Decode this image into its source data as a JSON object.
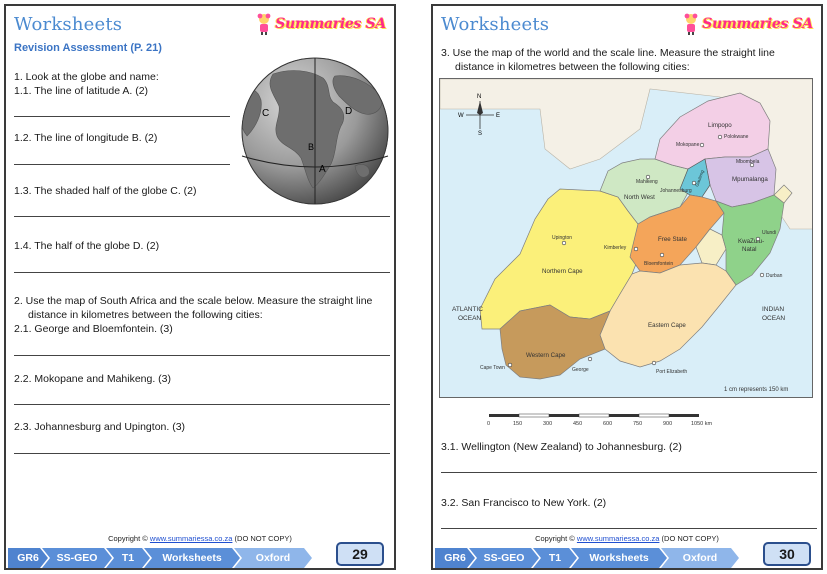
{
  "brand": {
    "name": "Summaries SA"
  },
  "pages": [
    {
      "title": "Worksheets",
      "subtitle": "Revision Assessment  (P. 21)",
      "intro": "1.  Look at the globe and name:",
      "questions": [
        "1.1.   The line of latitude A. (2)",
        "1.2.   The line of longitude B. (2)",
        "1.3.   The shaded half of the globe C. (2)",
        "1.4.   The half of the globe D. (2)"
      ],
      "q2_line1": "2.  Use the map of South Africa and the scale below. Measure the straight line",
      "q2_line2": "distance in kilometres between the following cities:",
      "q2": [
        "2.1.   George and Bloemfontein. (3)",
        "2.2.   Mokopane and Mahikeng. (3)",
        "2.3.   Johannesburg and Upington. (3)"
      ],
      "globe_labels": {
        "c": "C",
        "d": "D",
        "b": "B",
        "a": "A"
      },
      "page_number": "29"
    },
    {
      "title": "Worksheets",
      "q3_line1": "3.  Use the map of the world and the scale line. Measure the straight line",
      "q3_line2": "distance in kilometres between the following cities:",
      "q3": [
        "3.1.   Wellington (New Zealand) to Johannesburg. (2)",
        "3.2.   San Francisco to New York. (2)"
      ],
      "page_number": "30"
    }
  ],
  "copyright": {
    "prefix": "Copyright ©",
    "link": "www.summariessa.co.za",
    "suffix": "(DO NOT COPY)"
  },
  "footer_crumbs": [
    "GR6",
    "SS-GEO",
    "T1",
    "Worksheets",
    "Oxford"
  ],
  "map": {
    "compass": {
      "n": "N",
      "e": "E",
      "s": "S",
      "w": "W"
    },
    "provinces": {
      "limpopo": "Limpopo",
      "mpumalanga": "Mpumalanga",
      "north_west": "North West",
      "gauteng": "Gauteng",
      "free_state": "Free State",
      "kzn1": "KwaZulu-",
      "kzn2": "Natal",
      "northern_cape": "Northern Cape",
      "eastern_cape": "Eastern Cape",
      "western_cape": "Western Cape"
    },
    "cities": {
      "polokwane": "Polokwane",
      "mokopane": "Mokopane",
      "mbombela": "Mbombela",
      "mahikeng": "Mahikeng",
      "johannesburg": "Johannesburg",
      "ulundi": "Ulundi",
      "durban": "Durban",
      "upington": "Upington",
      "kimberley": "Kimberley",
      "bloemfontein": "Bloemfontein",
      "cape_town": "Cape Town",
      "george": "George",
      "port_elizabeth": "Port Elizabeth"
    },
    "oceans": {
      "atlantic1": "ATLANTIC",
      "atlantic2": "OCEAN",
      "indian1": "INDIAN",
      "indian2": "OCEAN"
    },
    "scale_note": "1 cm represents 150 km",
    "scale_ticks": [
      "0",
      "150",
      "300",
      "450",
      "600",
      "750",
      "900",
      "1050 km"
    ]
  },
  "colors": {
    "title": "#4b8ad0",
    "crumb": "#5b8fd8",
    "limpopo": "#f3cfe6",
    "mpumalanga": "#d7c4e6",
    "north_west": "#cfe8c4",
    "gauteng": "#6cc6d8",
    "free_state": "#f4a55a",
    "kzn": "#8fd28a",
    "northern_cape": "#fbf07a",
    "eastern_cape": "#fbe2b0",
    "western_cape": "#c69a5c"
  }
}
